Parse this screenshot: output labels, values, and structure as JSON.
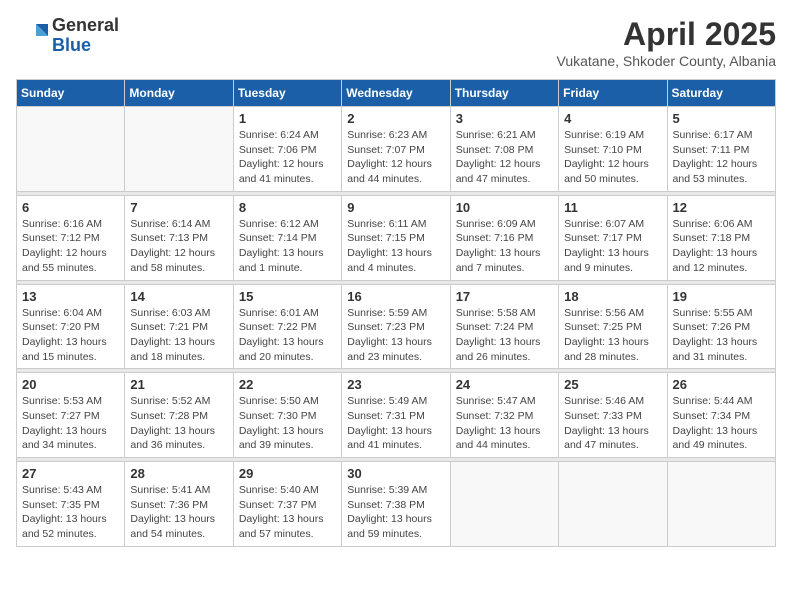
{
  "logo": {
    "general": "General",
    "blue": "Blue"
  },
  "title": "April 2025",
  "subtitle": "Vukatane, Shkoder County, Albania",
  "weekdays": [
    "Sunday",
    "Monday",
    "Tuesday",
    "Wednesday",
    "Thursday",
    "Friday",
    "Saturday"
  ],
  "weeks": [
    [
      {
        "day": "",
        "sunrise": "",
        "sunset": "",
        "daylight": ""
      },
      {
        "day": "",
        "sunrise": "",
        "sunset": "",
        "daylight": ""
      },
      {
        "day": "1",
        "sunrise": "Sunrise: 6:24 AM",
        "sunset": "Sunset: 7:06 PM",
        "daylight": "Daylight: 12 hours and 41 minutes."
      },
      {
        "day": "2",
        "sunrise": "Sunrise: 6:23 AM",
        "sunset": "Sunset: 7:07 PM",
        "daylight": "Daylight: 12 hours and 44 minutes."
      },
      {
        "day": "3",
        "sunrise": "Sunrise: 6:21 AM",
        "sunset": "Sunset: 7:08 PM",
        "daylight": "Daylight: 12 hours and 47 minutes."
      },
      {
        "day": "4",
        "sunrise": "Sunrise: 6:19 AM",
        "sunset": "Sunset: 7:10 PM",
        "daylight": "Daylight: 12 hours and 50 minutes."
      },
      {
        "day": "5",
        "sunrise": "Sunrise: 6:17 AM",
        "sunset": "Sunset: 7:11 PM",
        "daylight": "Daylight: 12 hours and 53 minutes."
      }
    ],
    [
      {
        "day": "6",
        "sunrise": "Sunrise: 6:16 AM",
        "sunset": "Sunset: 7:12 PM",
        "daylight": "Daylight: 12 hours and 55 minutes."
      },
      {
        "day": "7",
        "sunrise": "Sunrise: 6:14 AM",
        "sunset": "Sunset: 7:13 PM",
        "daylight": "Daylight: 12 hours and 58 minutes."
      },
      {
        "day": "8",
        "sunrise": "Sunrise: 6:12 AM",
        "sunset": "Sunset: 7:14 PM",
        "daylight": "Daylight: 13 hours and 1 minute."
      },
      {
        "day": "9",
        "sunrise": "Sunrise: 6:11 AM",
        "sunset": "Sunset: 7:15 PM",
        "daylight": "Daylight: 13 hours and 4 minutes."
      },
      {
        "day": "10",
        "sunrise": "Sunrise: 6:09 AM",
        "sunset": "Sunset: 7:16 PM",
        "daylight": "Daylight: 13 hours and 7 minutes."
      },
      {
        "day": "11",
        "sunrise": "Sunrise: 6:07 AM",
        "sunset": "Sunset: 7:17 PM",
        "daylight": "Daylight: 13 hours and 9 minutes."
      },
      {
        "day": "12",
        "sunrise": "Sunrise: 6:06 AM",
        "sunset": "Sunset: 7:18 PM",
        "daylight": "Daylight: 13 hours and 12 minutes."
      }
    ],
    [
      {
        "day": "13",
        "sunrise": "Sunrise: 6:04 AM",
        "sunset": "Sunset: 7:20 PM",
        "daylight": "Daylight: 13 hours and 15 minutes."
      },
      {
        "day": "14",
        "sunrise": "Sunrise: 6:03 AM",
        "sunset": "Sunset: 7:21 PM",
        "daylight": "Daylight: 13 hours and 18 minutes."
      },
      {
        "day": "15",
        "sunrise": "Sunrise: 6:01 AM",
        "sunset": "Sunset: 7:22 PM",
        "daylight": "Daylight: 13 hours and 20 minutes."
      },
      {
        "day": "16",
        "sunrise": "Sunrise: 5:59 AM",
        "sunset": "Sunset: 7:23 PM",
        "daylight": "Daylight: 13 hours and 23 minutes."
      },
      {
        "day": "17",
        "sunrise": "Sunrise: 5:58 AM",
        "sunset": "Sunset: 7:24 PM",
        "daylight": "Daylight: 13 hours and 26 minutes."
      },
      {
        "day": "18",
        "sunrise": "Sunrise: 5:56 AM",
        "sunset": "Sunset: 7:25 PM",
        "daylight": "Daylight: 13 hours and 28 minutes."
      },
      {
        "day": "19",
        "sunrise": "Sunrise: 5:55 AM",
        "sunset": "Sunset: 7:26 PM",
        "daylight": "Daylight: 13 hours and 31 minutes."
      }
    ],
    [
      {
        "day": "20",
        "sunrise": "Sunrise: 5:53 AM",
        "sunset": "Sunset: 7:27 PM",
        "daylight": "Daylight: 13 hours and 34 minutes."
      },
      {
        "day": "21",
        "sunrise": "Sunrise: 5:52 AM",
        "sunset": "Sunset: 7:28 PM",
        "daylight": "Daylight: 13 hours and 36 minutes."
      },
      {
        "day": "22",
        "sunrise": "Sunrise: 5:50 AM",
        "sunset": "Sunset: 7:30 PM",
        "daylight": "Daylight: 13 hours and 39 minutes."
      },
      {
        "day": "23",
        "sunrise": "Sunrise: 5:49 AM",
        "sunset": "Sunset: 7:31 PM",
        "daylight": "Daylight: 13 hours and 41 minutes."
      },
      {
        "day": "24",
        "sunrise": "Sunrise: 5:47 AM",
        "sunset": "Sunset: 7:32 PM",
        "daylight": "Daylight: 13 hours and 44 minutes."
      },
      {
        "day": "25",
        "sunrise": "Sunrise: 5:46 AM",
        "sunset": "Sunset: 7:33 PM",
        "daylight": "Daylight: 13 hours and 47 minutes."
      },
      {
        "day": "26",
        "sunrise": "Sunrise: 5:44 AM",
        "sunset": "Sunset: 7:34 PM",
        "daylight": "Daylight: 13 hours and 49 minutes."
      }
    ],
    [
      {
        "day": "27",
        "sunrise": "Sunrise: 5:43 AM",
        "sunset": "Sunset: 7:35 PM",
        "daylight": "Daylight: 13 hours and 52 minutes."
      },
      {
        "day": "28",
        "sunrise": "Sunrise: 5:41 AM",
        "sunset": "Sunset: 7:36 PM",
        "daylight": "Daylight: 13 hours and 54 minutes."
      },
      {
        "day": "29",
        "sunrise": "Sunrise: 5:40 AM",
        "sunset": "Sunset: 7:37 PM",
        "daylight": "Daylight: 13 hours and 57 minutes."
      },
      {
        "day": "30",
        "sunrise": "Sunrise: 5:39 AM",
        "sunset": "Sunset: 7:38 PM",
        "daylight": "Daylight: 13 hours and 59 minutes."
      },
      {
        "day": "",
        "sunrise": "",
        "sunset": "",
        "daylight": ""
      },
      {
        "day": "",
        "sunrise": "",
        "sunset": "",
        "daylight": ""
      },
      {
        "day": "",
        "sunrise": "",
        "sunset": "",
        "daylight": ""
      }
    ]
  ]
}
